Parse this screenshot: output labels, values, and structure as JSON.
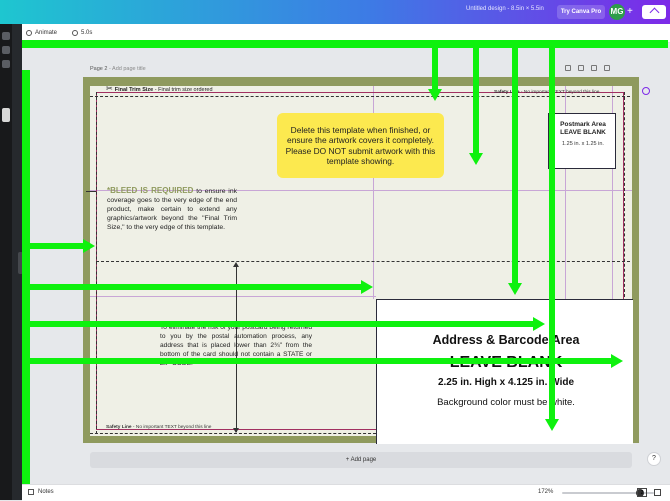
{
  "topbar": {
    "design_title": "Untitled design - 8.5in × 5.5in",
    "try_pro_label": "Try Canva Pro",
    "avatar_initials": "MG",
    "add_member_label": "+"
  },
  "toolbar": {
    "animate_label": "Animate",
    "duration_label": "5.0s"
  },
  "page": {
    "label": "Page 2",
    "title_placeholder": "Add page title"
  },
  "template": {
    "final_trim_label": "Final Trim Size",
    "final_trim_desc": " - Final trim size ordered",
    "safety_top_label": "Safety Line",
    "safety_top_desc": " - No important TEXT beyond this line",
    "safety_bottom_label": "Safety Line",
    "safety_bottom_desc": " - No important TEXT beyond this line",
    "callout": "Delete this template when finished, or ensure the artwork covers it completely. Please DO NOT submit artwork with this template showing.",
    "bleed_head": "*BLEED IS REQUIRED",
    "bleed_body": " to ensure ink coverage goes to the very edge of the end product, make certain to extend any graphics/artwork beyond the \"Final Trim Size,\" to the very edge of this template.",
    "return_note": "To eliminate the risk of your postcard being returned to you by the postal automation process, any address that is placed lower than 2¾\" from the bottom of the card should not contain a STATE or ZIP CODE.",
    "postmark_title": "Postmark Area LEAVE BLANK",
    "postmark_size": "1.25 in. x 1.25 in.",
    "address_title": "Address & Barcode Area",
    "address_leave": "LEAVE BLANK",
    "address_size": "2.25 in. High x 4.125 in. Wide",
    "address_bg": "Background color must be white."
  },
  "add_page_label": "+ Add page",
  "bottombar": {
    "notes_label": "Notes",
    "zoom_label": "172%",
    "zoom_fraction": 0.85,
    "page_counter": "2"
  },
  "colors": {
    "bleed_border": "#8f9a5e",
    "inner_bg": "#eff0e6",
    "callout_bg": "#fce94f",
    "overlay_arrow": "#0ef10e",
    "trim_line": "#a13060"
  },
  "icons": {
    "scissors": "✂",
    "help": "?"
  }
}
